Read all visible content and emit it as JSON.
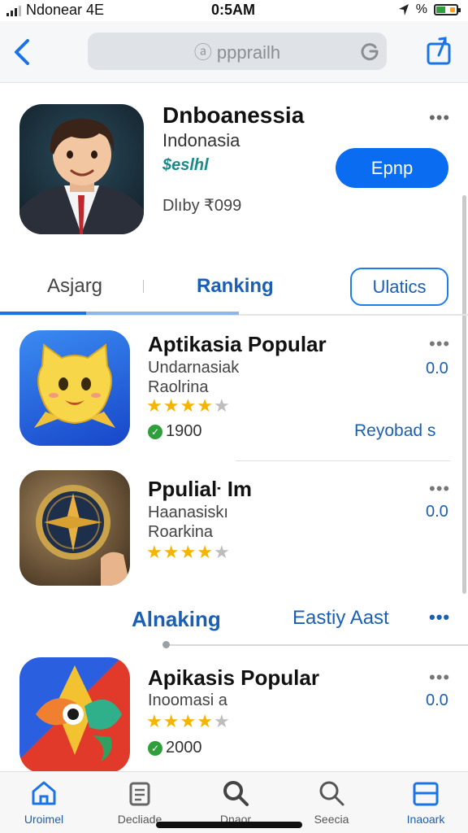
{
  "status_bar": {
    "carrier": "Ndonear 4E",
    "time": "0:5AM",
    "percent": "%",
    "battery_level": 0.45
  },
  "nav": {
    "search_text": "ppprailh",
    "back_icon": "chevron-left-icon",
    "share_icon": "share-icon"
  },
  "hero": {
    "title": "Dnboanessia",
    "subtitle": "Indonasia",
    "tag": "$eslhl",
    "meta": "Dlıby ₹099",
    "get_label": "Epnp",
    "more": "•••"
  },
  "tabs": {
    "tab1": "Asjarg",
    "tab2": "Ranking",
    "tab3": "Ulatics"
  },
  "apps": [
    {
      "name": "Aptikasia Popular",
      "line1": "Undarnasiak",
      "line2": "Raolrina",
      "rating": 4,
      "count": "1900",
      "price": "0.0",
      "action": "Reyobad s",
      "more": "•••"
    },
    {
      "name": "Ppuliaŀ Im",
      "line1": "Haanasiskı",
      "line2": "Roarkina",
      "rating": 4,
      "price": "0.0",
      "more": "•••"
    },
    {
      "name": "Apikasis Popular",
      "line1": "Inoomasi a",
      "rating": 4,
      "count": "2000",
      "price": "0.0",
      "more": "•••"
    }
  ],
  "section": {
    "title": "Alnaking",
    "link": "Eastiy Aast",
    "more": "•••"
  },
  "tab_bar": [
    {
      "label": "Uroimel",
      "icon": "home-icon",
      "active": true
    },
    {
      "label": "Decliade",
      "icon": "clipboard-icon",
      "active": false
    },
    {
      "label": "Dnaor",
      "icon": "search-icon",
      "active": false
    },
    {
      "label": "Seecia",
      "icon": "search-icon",
      "active": false
    },
    {
      "label": "Inaoark",
      "icon": "panel-icon",
      "active": true
    }
  ],
  "colors": {
    "accent": "#0a6cf1",
    "link": "#1a5fb4",
    "star": "#f4b400"
  }
}
